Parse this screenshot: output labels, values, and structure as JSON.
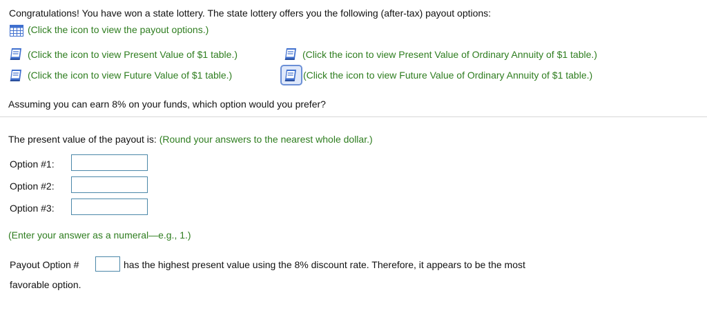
{
  "intro": {
    "text": "Congratulations! You have won a state lottery. The state lottery offers you the following (after-tax) payout options:",
    "payout_link": "(Click the icon to view the payout options.)"
  },
  "tables": {
    "pv_single": "(Click the icon to view Present Value of $1 table.)",
    "pv_annuity": "(Click the icon to view Present Value of Ordinary Annuity of $1 table.)",
    "fv_single": "(Click the icon to view Future Value of $1 table.)",
    "fv_annuity": "(Click the icon to view Future Value of Ordinary Annuity of $1 table.)"
  },
  "question": "Assuming you can earn 8% on your funds, which option would you prefer?",
  "pv_section": {
    "prompt": "The present value of the payout is:",
    "hint": "(Round your answers to the nearest whole dollar.)",
    "options": [
      {
        "label": "Option #1:",
        "value": ""
      },
      {
        "label": "Option #2:",
        "value": ""
      },
      {
        "label": "Option #3:",
        "value": ""
      }
    ]
  },
  "numeral_hint": "(Enter your answer as a numeral—e.g., 1.)",
  "conclusion": {
    "prefix": "Payout Option #",
    "value": "",
    "suffix": "has the highest present value using the 8% discount rate. Therefore, it appears to be the most",
    "line2": "favorable option."
  },
  "colors": {
    "hint_green": "#2e7d1f",
    "input_border": "#4a87a8",
    "icon_blue": "#3f6fce"
  },
  "icons": {
    "payout": "table-grid-icon",
    "tables": "book-icon"
  }
}
